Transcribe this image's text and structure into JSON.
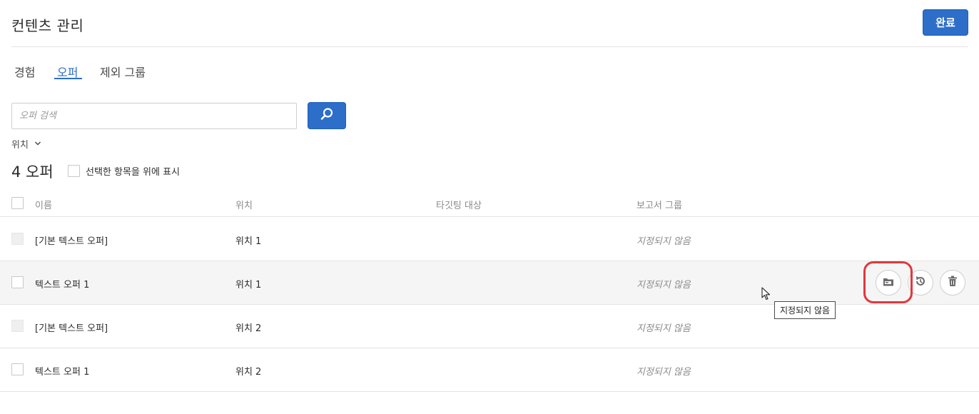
{
  "header": {
    "title": "컨텐츠 관리",
    "done_label": "완료"
  },
  "tabs": [
    {
      "label": "경험",
      "active": false
    },
    {
      "label": "오퍼",
      "active": true
    },
    {
      "label": "제외 그룹",
      "active": false
    }
  ],
  "search": {
    "placeholder": "오퍼 검색",
    "value": ""
  },
  "filter": {
    "location_label": "위치"
  },
  "summary": {
    "count_label": "4 오퍼",
    "show_selected_label": "선택한 항목을 위에 표시"
  },
  "table": {
    "columns": [
      "이름",
      "위치",
      "타깃팅 대상",
      "보고서 그룹"
    ],
    "rows": [
      {
        "name": "[기본 텍스트 오퍼]",
        "location": "위치 1",
        "targeting": "",
        "report_group": "지정되지 않음",
        "disabled": true
      },
      {
        "name": "텍스트 오퍼 1",
        "location": "위치 1",
        "targeting": "",
        "report_group": "지정되지 않음",
        "disabled": false,
        "hovered": true
      },
      {
        "name": "[기본 텍스트 오퍼]",
        "location": "위치 2",
        "targeting": "",
        "report_group": "지정되지 않음",
        "disabled": true
      },
      {
        "name": "텍스트 오퍼 1",
        "location": "위치 2",
        "targeting": "",
        "report_group": "지정되지 않음",
        "disabled": false
      }
    ]
  },
  "row_actions": {
    "icons": [
      "folder-icon",
      "history-icon",
      "trash-icon"
    ]
  },
  "tooltip": {
    "text": "지정되지 않음"
  },
  "colors": {
    "accent": "#2d6ec9",
    "highlight": "#e0383e",
    "hover_row": "#f5f5f5"
  }
}
